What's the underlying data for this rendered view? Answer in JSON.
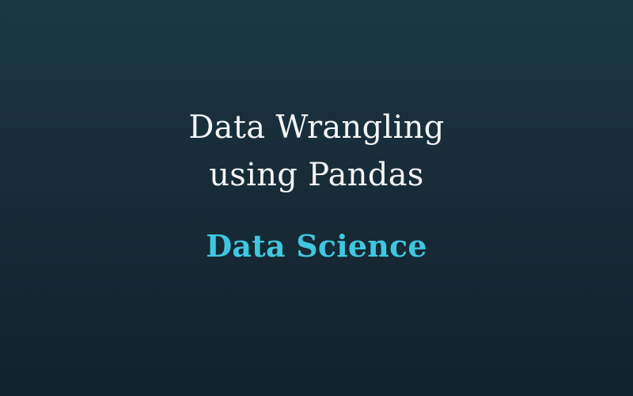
{
  "banner": {
    "title_line_1": "Data Wrangling",
    "title_line_2": "using Pandas",
    "subtitle": "Data Science",
    "colors": {
      "background_top": "#1c3844",
      "background_bottom": "#12222c",
      "title": "#f4f4f4",
      "subtitle": "#40c7df"
    }
  }
}
